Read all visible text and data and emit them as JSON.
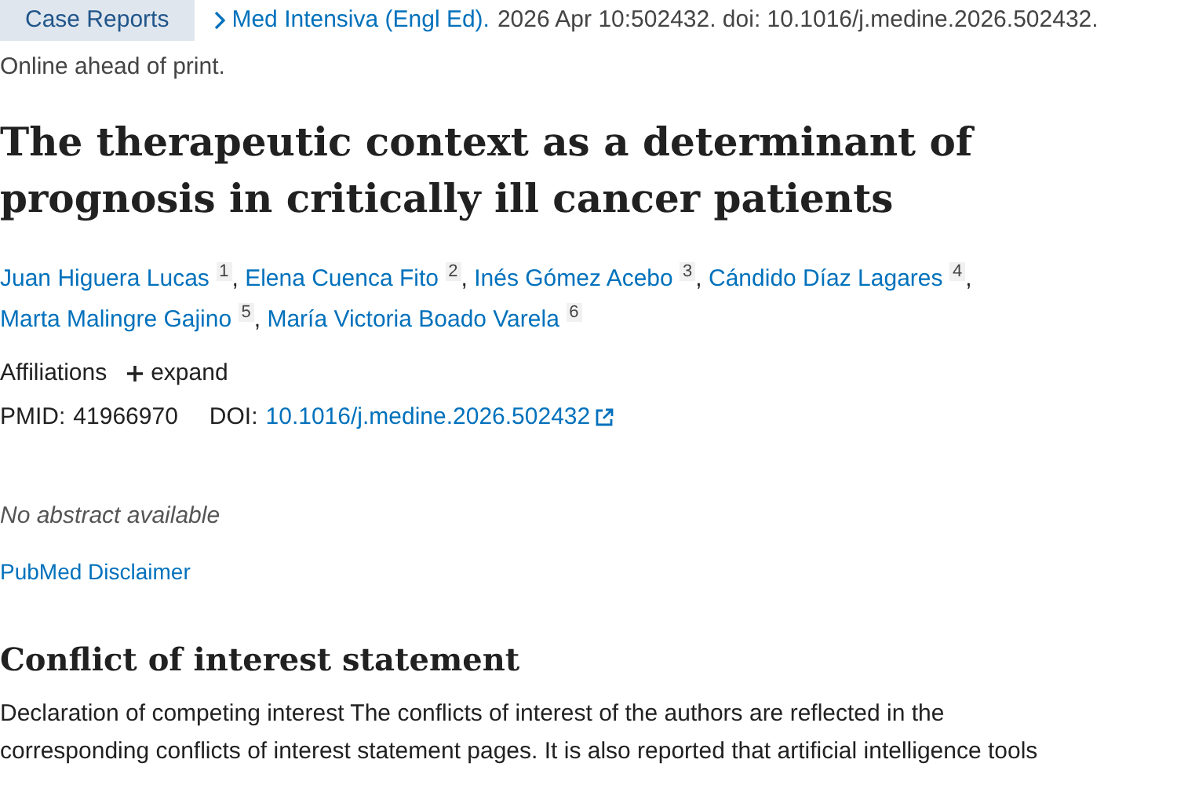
{
  "publication_type": "Case Reports",
  "citation": {
    "journal": "Med Intensiva (Engl Ed).",
    "details": "2026 Apr 10:502432. doi: 10.1016/j.medine.2026.502432."
  },
  "status": "Online ahead of print.",
  "title": "The therapeutic context as a determinant of prognosis in critically ill cancer patients",
  "authors": [
    {
      "name": "Juan Higuera Lucas",
      "affiliation": "1",
      "separator": ","
    },
    {
      "name": "Elena Cuenca Fito",
      "affiliation": "2",
      "separator": ","
    },
    {
      "name": "Inés Gómez Acebo",
      "affiliation": "3",
      "separator": ","
    },
    {
      "name": "Cándido Díaz Lagares",
      "affiliation": "4",
      "separator": ","
    },
    {
      "name": "Marta Malingre Gajino",
      "affiliation": "5",
      "separator": ","
    },
    {
      "name": "María Victoria Boado Varela",
      "affiliation": "6"
    }
  ],
  "affiliations": {
    "label": "Affiliations",
    "toggle": "expand",
    "expanded": false
  },
  "identifiers": {
    "pmid_label": "PMID:",
    "pmid": "41966970",
    "doi_label": "DOI:",
    "doi": "10.1016/j.medine.2026.502432"
  },
  "abstract": "No abstract available",
  "disclaimer_link": "PubMed Disclaimer",
  "sections": [
    {
      "heading": "Conflict of interest statement",
      "text": "Declaration of competing interest The conflicts of interest of the authors are reflected in the corresponding conflicts of interest statement pages. It is also reported that artificial intelligence tools"
    }
  ]
}
